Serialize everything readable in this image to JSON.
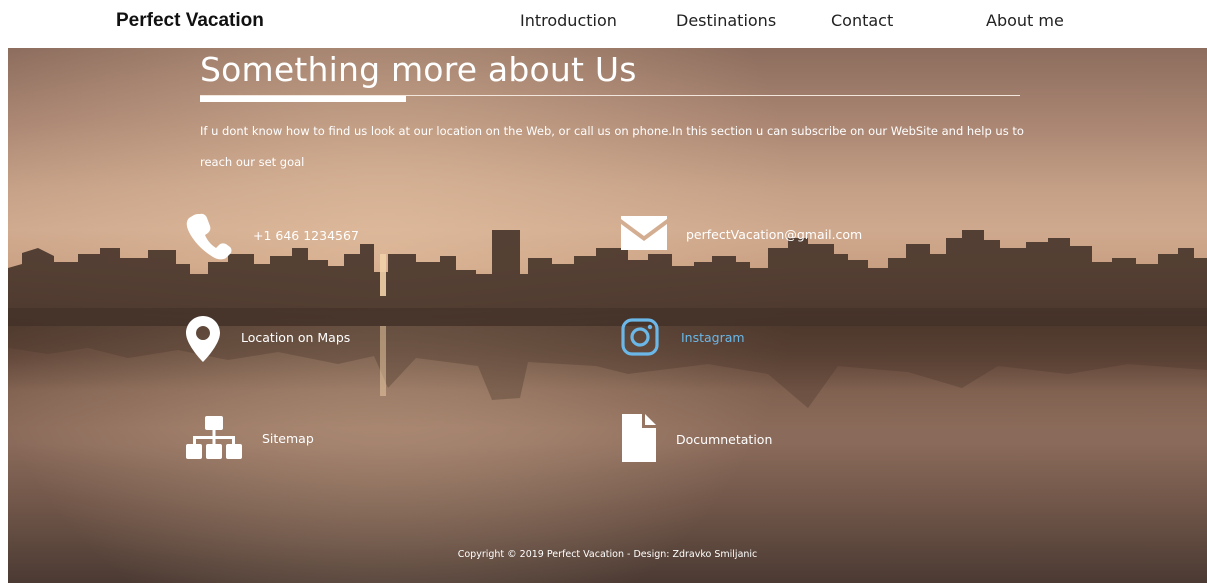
{
  "navbar": {
    "brand": "Perfect Vacation",
    "links": [
      "Introduction",
      "Destinations",
      "Contact",
      "About me"
    ]
  },
  "section": {
    "title": "Something more about Us",
    "intro": "If u dont know how to find us look at our location on the Web, or call us on phone.In this section u can subscribe on our WebSite and help us to reach our set goal"
  },
  "contacts": {
    "phone": {
      "icon": "phone-icon",
      "label": "+1 646 1234567"
    },
    "email": {
      "icon": "envelope-icon",
      "label": "perfectVacation@gmail.com"
    },
    "location": {
      "icon": "map-marker-icon",
      "label": "Location on Maps"
    },
    "instagram": {
      "icon": "instagram-icon",
      "label": "Instagram"
    },
    "sitemap": {
      "icon": "sitemap-icon",
      "label": "Sitemap"
    },
    "documentation": {
      "icon": "document-icon",
      "label": "Documnetation"
    }
  },
  "footer": {
    "copyright": "Copyright © 2019 Perfect Vacation - Design: Zdravko Smiljanic"
  },
  "colors": {
    "instagram_accent": "#6ab7e8",
    "text": "#ffffff",
    "sky_warm": "#cfa98e"
  }
}
